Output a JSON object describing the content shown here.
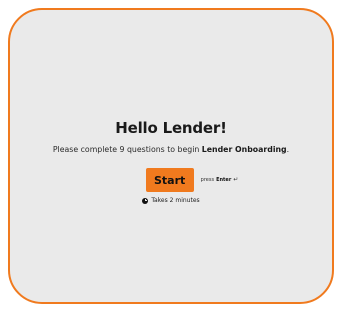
{
  "welcome": {
    "title": "Hello Lender!",
    "intro_prefix": "Please complete 9 questions to begin ",
    "intro_bold": "Lender Onboarding",
    "intro_suffix": "."
  },
  "start": {
    "button_label": "Start",
    "hint_prefix": "press",
    "hint_key": "Enter",
    "hint_icon": "↵"
  },
  "duration": {
    "icon": "clock-icon",
    "text": "Takes 2 minutes"
  },
  "colors": {
    "accent": "#f07a1e",
    "background": "#eaeaea"
  }
}
